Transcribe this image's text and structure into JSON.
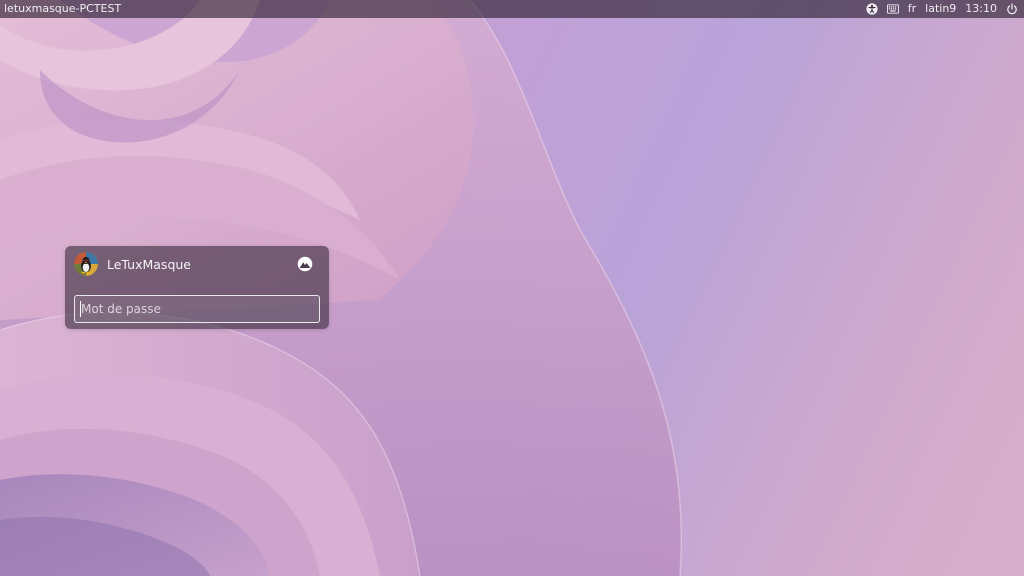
{
  "panel": {
    "hostname": "letuxmasque-PCTEST",
    "indicators": {
      "accessibility_icon": "accessibility-icon",
      "keyboard_icon": "keyboard-icon",
      "layout": "fr",
      "variant": "latin9",
      "clock": "13:10",
      "power_icon": "power-icon"
    }
  },
  "login": {
    "username": "LeTuxMasque",
    "avatar_icon": "tux-avatar",
    "session_icon": "session-chooser-icon",
    "password_placeholder": "Mot de passe",
    "password_value": ""
  },
  "colors": {
    "panel_bg": "#281c2c",
    "card_bg": "#342838",
    "text": "#f6f2f6"
  }
}
